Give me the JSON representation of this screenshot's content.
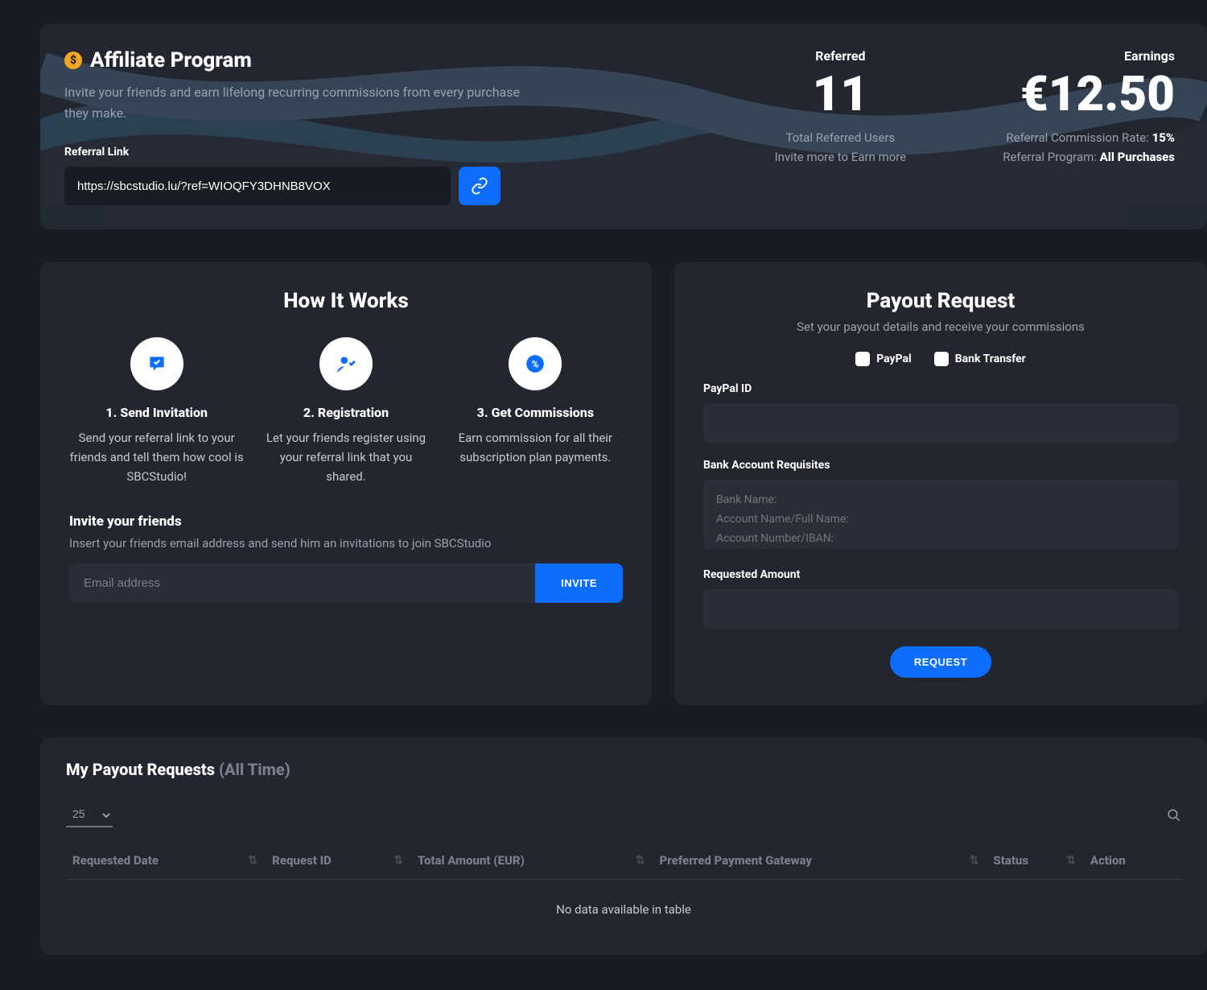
{
  "hero": {
    "title": "Affiliate Program",
    "subtitle": "Invite your friends and earn lifelong recurring commissions from every purchase they make.",
    "referral_label": "Referral Link",
    "referral_url": "https://sbcstudio.lu/?ref=WIOQFY3DHNB8VOX",
    "referred": {
      "label": "Referred",
      "value": "11",
      "sub1": "Total Referred Users",
      "sub2": "Invite more to Earn more"
    },
    "earnings": {
      "label": "Earnings",
      "value": "€12.50",
      "rate_label": "Referral Commission Rate: ",
      "rate": "15%",
      "prog_label": "Referral Program: ",
      "prog": "All Purchases"
    }
  },
  "how": {
    "title": "How It Works",
    "steps": [
      {
        "title": "1. Send Invitation",
        "text": "Send your referral link to your friends and tell them how cool is SBCStudio!"
      },
      {
        "title": "2. Registration",
        "text": "Let your friends register using your referral link that you shared."
      },
      {
        "title": "3. Get Commissions",
        "text": "Earn commission for all their subscription plan payments."
      }
    ],
    "invite_title": "Invite your friends",
    "invite_sub": "Insert your friends email address and send him an invitations to join SBCStudio",
    "email_placeholder": "Email address",
    "invite_btn": "INVITE"
  },
  "payout": {
    "title": "Payout Request",
    "sub": "Set your payout details and receive your commissions",
    "paypal_opt": "PayPal",
    "bank_opt": "Bank Transfer",
    "paypal_label": "PayPal ID",
    "bank_label": "Bank Account Requisites",
    "bank_placeholder": "Bank Name:\nAccount Name/Full Name:\nAccount Number/IBAN:",
    "amount_label": "Requested Amount",
    "request_btn": "REQUEST"
  },
  "table": {
    "title": "My Payout Requests ",
    "title_muted": "(All Time)",
    "page_size": "25",
    "cols": [
      "Requested Date",
      "Request ID",
      "Total Amount (EUR)",
      "Preferred Payment Gateway",
      "Status",
      "Action"
    ],
    "empty": "No data available in table"
  }
}
